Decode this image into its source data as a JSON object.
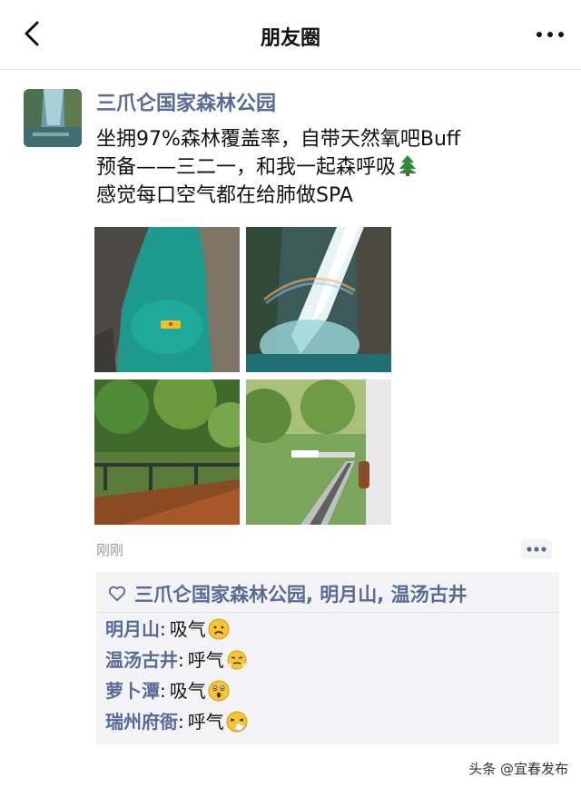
{
  "nav": {
    "title": "朋友圈"
  },
  "post": {
    "author": "三爪仑国家森林公园",
    "text_lines": [
      "坐拥97%森林覆盖率，自带天然氧吧Buff",
      "预备——三二一，和我一起森呼吸",
      "感觉每口空气都在给肺做SPA"
    ],
    "text_emoji": "evergreen-tree",
    "photos": [
      "gorge-pool-raft-photo",
      "waterfall-rainbow-photo",
      "forest-boardwalk-leaves-photo",
      "mountain-train-track-photo"
    ],
    "timestamp": "刚刚"
  },
  "likes": {
    "names": "三爪仑国家森林公园, 明月山, 温汤古井"
  },
  "comments": [
    {
      "name": "明月山",
      "text": "吸气",
      "emoji": "frowning-face"
    },
    {
      "name": "温汤古井",
      "text": "呼气",
      "emoji": "face-with-steam"
    },
    {
      "name": "萝卜潭",
      "text": "吸气",
      "emoji": "astonished-face"
    },
    {
      "name": "瑞州府衙",
      "text": "呼气",
      "emoji": "sneezing-face"
    }
  ],
  "watermark": "头条 @宜春发布"
}
